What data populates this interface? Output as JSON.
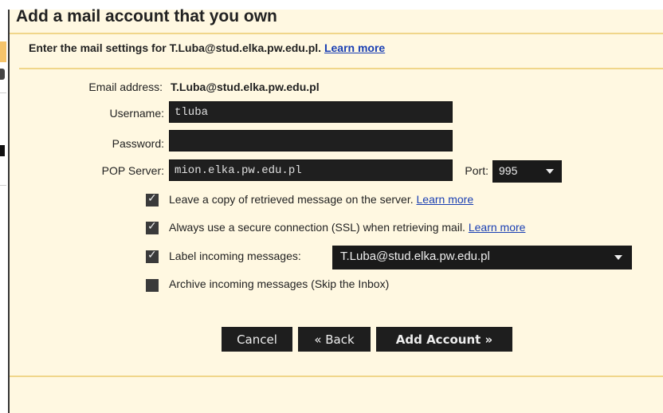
{
  "dialog": {
    "title": "Add a mail account that you own",
    "subtitle_text": "Enter the mail settings for T.Luba@stud.elka.pw.edu.pl.",
    "learn_more": "Learn more"
  },
  "form": {
    "email_label": "Email address:",
    "email_value": "T.Luba@stud.elka.pw.edu.pl",
    "username_label": "Username:",
    "username_value": "tluba",
    "password_label": "Password:",
    "password_value": "",
    "pop_label": "POP Server:",
    "pop_value": "mion.elka.pw.edu.pl",
    "port_label": "Port:",
    "port_value": "995"
  },
  "options": {
    "leave_copy": {
      "label": "Leave a copy of retrieved message on the server.",
      "checked": true,
      "link": "Learn more"
    },
    "ssl": {
      "label": "Always use a secure connection (SSL) when retrieving mail.",
      "checked": true,
      "link": "Learn more"
    },
    "label_incoming": {
      "label": "Label incoming messages:",
      "checked": true,
      "selected": "T.Luba@stud.elka.pw.edu.pl"
    },
    "archive": {
      "label": "Archive incoming messages (Skip the Inbox)",
      "checked": false
    }
  },
  "buttons": {
    "cancel": "Cancel",
    "back": "« Back",
    "add": "Add Account »"
  },
  "colors": {
    "dialog_bg": "#fff8e1",
    "rule": "#f0d68a",
    "link": "#1a3fb3",
    "input_bg": "#1f1f1f"
  },
  "icons": {
    "checkbox_checked": "check-mark",
    "dropdown": "caret-down"
  }
}
